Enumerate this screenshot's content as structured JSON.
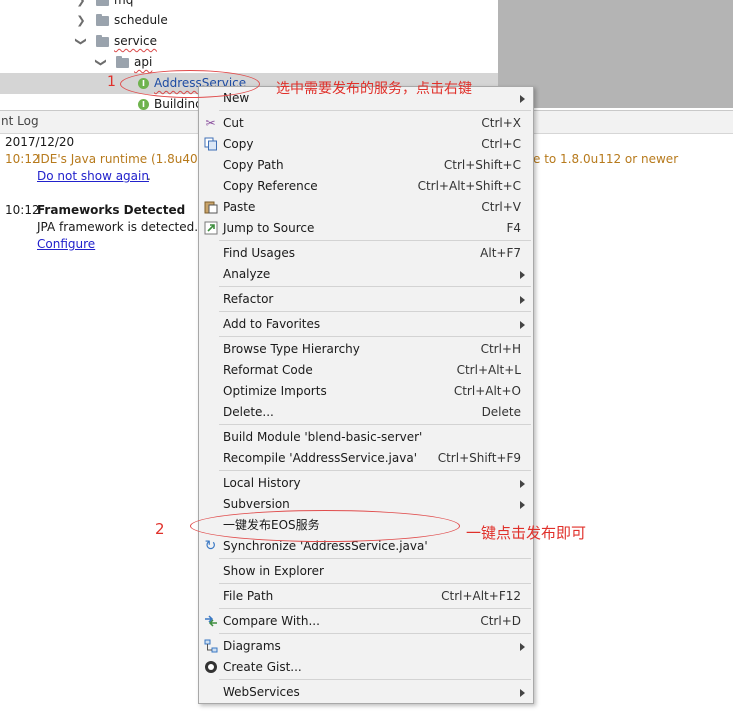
{
  "tree": {
    "items": [
      {
        "label": "mq"
      },
      {
        "label": "schedule"
      },
      {
        "label": "service"
      },
      {
        "label": "api"
      },
      {
        "label": "AddressService"
      },
      {
        "label": "Buildinc"
      }
    ],
    "interface_badge": "I"
  },
  "log": {
    "title": "nt Log",
    "date": "2017/12/20",
    "entry1_time": "10:12",
    "entry1_text": "IDE's Java runtime (1.8u40)",
    "entry1_tail": "e to 1.8.0u112 or newer",
    "entry1_link": "Do not show again",
    "entry1_dot": ".",
    "entry2_time": "10:12",
    "entry2_title": "Frameworks Detected",
    "entry2_text": "JPA framework is detected.",
    "entry2_link": "Configure"
  },
  "menu": {
    "new": "New",
    "cut": "Cut",
    "cut_sc": "Ctrl+X",
    "copy": "Copy",
    "copy_sc": "Ctrl+C",
    "copy_path": "Copy Path",
    "copy_path_sc": "Ctrl+Shift+C",
    "copy_reference": "Copy Reference",
    "copy_reference_sc": "Ctrl+Alt+Shift+C",
    "paste": "Paste",
    "paste_sc": "Ctrl+V",
    "jump_to_source": "Jump to Source",
    "jump_to_source_sc": "F4",
    "find_usages": "Find Usages",
    "find_usages_sc": "Alt+F7",
    "analyze": "Analyze",
    "refactor": "Refactor",
    "add_to_favorites": "Add to Favorites",
    "browse_type_hierarchy": "Browse Type Hierarchy",
    "browse_type_hierarchy_sc": "Ctrl+H",
    "reformat_code": "Reformat Code",
    "reformat_code_sc": "Ctrl+Alt+L",
    "optimize_imports": "Optimize Imports",
    "optimize_imports_sc": "Ctrl+Alt+O",
    "delete": "Delete...",
    "delete_sc": "Delete",
    "build_module": "Build Module 'blend-basic-server'",
    "recompile": "Recompile 'AddressService.java'",
    "recompile_sc": "Ctrl+Shift+F9",
    "local_history": "Local History",
    "subversion": "Subversion",
    "publish_eos": "一键发布EOS服务",
    "synchronize": "Synchronize 'AddressService.java'",
    "show_in_explorer": "Show in Explorer",
    "file_path": "File Path",
    "file_path_sc": "Ctrl+Alt+F12",
    "compare_with": "Compare With...",
    "compare_with_sc": "Ctrl+D",
    "diagrams": "Diagrams",
    "create_gist": "Create Gist...",
    "webservices": "WebServices"
  },
  "annotations": {
    "step1_number": "1",
    "step1_text": "选中需要发布的服务，点击右键",
    "step2_number": "2",
    "step2_text": "一键点击发布即可"
  }
}
